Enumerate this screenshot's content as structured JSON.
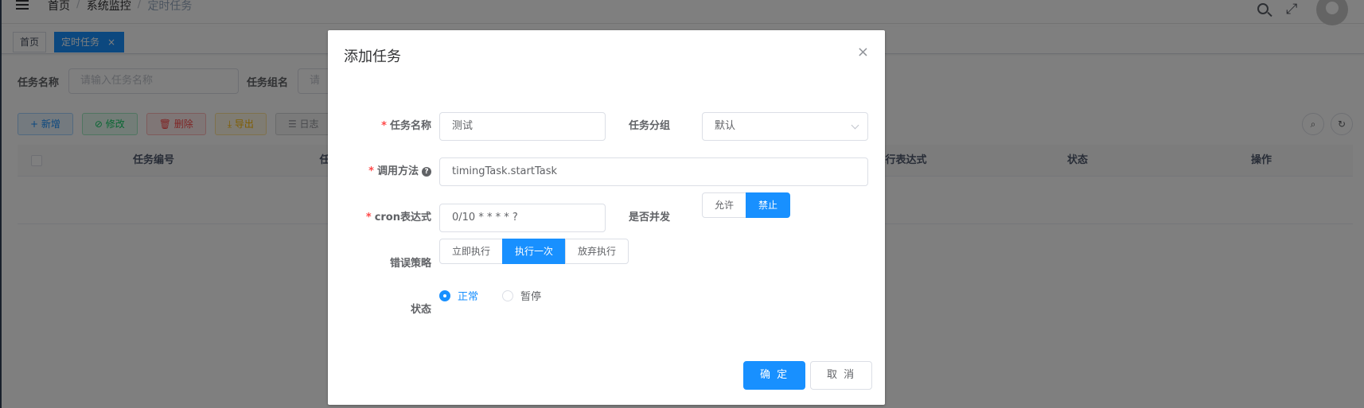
{
  "navbar": {
    "breadcrumb": [
      "首页",
      "系统监控",
      "定时任务"
    ],
    "breadcrumb_sep": "/",
    "fullscreen_glyph": "⤢"
  },
  "tags": [
    {
      "label": "首页"
    },
    {
      "label": "定时任务",
      "close": "×"
    }
  ],
  "search_form": {
    "job_name_label": "任务名称",
    "job_name_placeholder": "请输入任务名称",
    "job_group_label": "任务组名",
    "job_group_placeholder": "请"
  },
  "toolbar": {
    "add": "+ 新增",
    "edit": "⊘ 修改",
    "delete": "🗑 删除",
    "export": "⤓ 导出",
    "log": "☰ 日志"
  },
  "table": {
    "headers": [
      "任务编号",
      "任",
      "执行表达式",
      "状态",
      "操作"
    ]
  },
  "dialog": {
    "title": "添加任务",
    "close": "×",
    "required_mark": "*",
    "job_name_label": "任务名称",
    "job_name_value": "测试",
    "job_group_label": "任务分组",
    "job_group_value": "默认",
    "invoke_label": "调用方法",
    "help_glyph": "?",
    "invoke_value": "timingTask.startTask",
    "cron_label": "cron表达式",
    "cron_value": "0/10 * * * * ?",
    "concurrent_label": "是否并发",
    "concurrent_options": [
      "允许",
      "禁止"
    ],
    "concurrent_selected": "禁止",
    "misfire_label": "错误策略",
    "misfire_options": [
      "立即执行",
      "执行一次",
      "放弃执行"
    ],
    "misfire_selected": "执行一次",
    "status_label": "状态",
    "status_options": [
      "正常",
      "暂停"
    ],
    "status_selected": "正常",
    "confirm": "确 定",
    "cancel": "取 消"
  },
  "colors": {
    "primary": "#1890ff",
    "required": "#ff4949",
    "mask": "rgba(0,0,0,0.5)"
  },
  "icons": [
    "hamburger-icon",
    "search-icon",
    "fullscreen-icon",
    "avatar",
    "close-icon",
    "help-icon",
    "chevron-down-icon",
    "refresh-icon"
  ]
}
